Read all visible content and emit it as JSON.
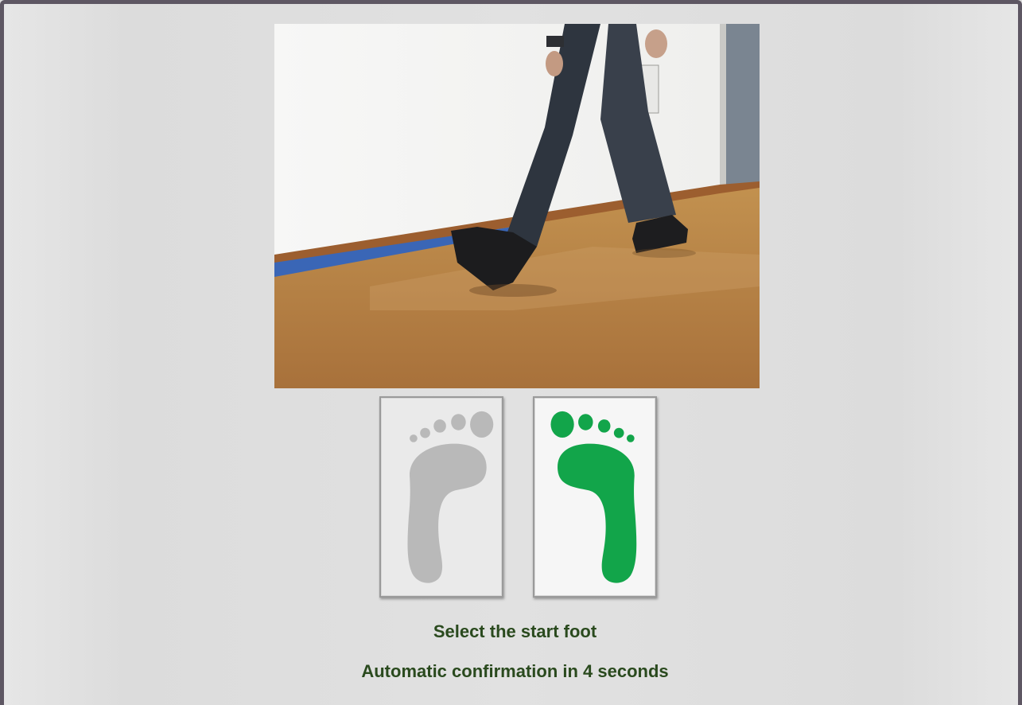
{
  "instructions": {
    "prompt": "Select the start foot",
    "countdown": "Automatic confirmation in 4 seconds"
  },
  "foot_buttons": [
    {
      "side": "left",
      "state": "inactive",
      "color": "#b9b9b9"
    },
    {
      "side": "right",
      "state": "selected",
      "color": "#12a54a"
    }
  ],
  "colors": {
    "text": "#2a4a1e",
    "window_border": "#5e5763",
    "selected_foot": "#12a54a",
    "inactive_foot": "#b9b9b9"
  }
}
